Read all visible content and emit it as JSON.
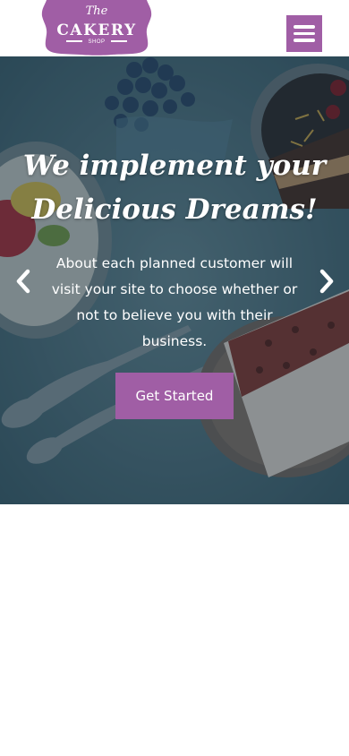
{
  "header": {
    "logo": {
      "line1": "The",
      "line2": "CAKERY",
      "line3": "SHOP"
    },
    "menu_icon": "hamburger-menu-icon"
  },
  "hero": {
    "headline_line1": "We implement your",
    "headline_line2": "Delicious Dreams!",
    "subtext": "About each planned customer will visit your site to choose whether or not to believe you with their business.",
    "cta_label": "Get Started",
    "prev_icon": "chevron-left-icon",
    "next_icon": "chevron-right-icon"
  },
  "colors": {
    "accent": "#a05ea5",
    "overlay": "#142837",
    "text_light": "#ffffff"
  }
}
